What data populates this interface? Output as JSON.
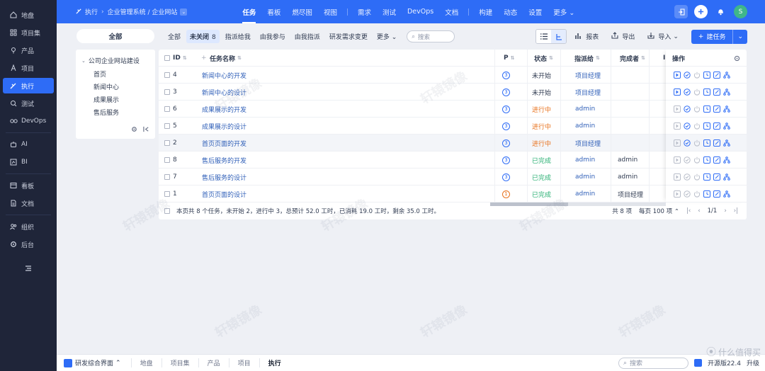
{
  "sidebar": {
    "items": [
      {
        "label": "地盘",
        "icon": "home-icon"
      },
      {
        "label": "项目集",
        "icon": "grid-icon"
      },
      {
        "label": "产品",
        "icon": "pin-icon"
      },
      {
        "label": "项目",
        "icon": "project-icon"
      },
      {
        "label": "执行",
        "icon": "run-icon",
        "active": true
      },
      {
        "label": "测试",
        "icon": "search-icon"
      },
      {
        "label": "DevOps",
        "icon": "infinity-icon"
      },
      {
        "label": "AI",
        "icon": "robot-icon"
      },
      {
        "label": "BI",
        "icon": "chart-icon"
      },
      {
        "label": "看板",
        "icon": "kanban-icon"
      },
      {
        "label": "文档",
        "icon": "doc-icon"
      },
      {
        "label": "组织",
        "icon": "people-icon"
      },
      {
        "label": "后台",
        "icon": "gear-icon"
      }
    ]
  },
  "topbar": {
    "breadcrumb": [
      "执行",
      "企业管理系统 / 企业网站"
    ],
    "nav": [
      "任务",
      "看板",
      "燃尽图",
      "视图",
      "需求",
      "测试",
      "DevOps",
      "文档",
      "构建",
      "动态",
      "设置",
      "更多"
    ],
    "active_nav": "任务",
    "avatar_letter": "S"
  },
  "filters": {
    "all_label": "全部",
    "tabs": [
      {
        "label": "全部"
      },
      {
        "label": "未关闭",
        "count": "8",
        "selected": true
      },
      {
        "label": "指派给我"
      },
      {
        "label": "由我参与"
      },
      {
        "label": "由我指派"
      },
      {
        "label": "研发需求变更"
      },
      {
        "label": "更多"
      }
    ],
    "search_placeholder": "搜索",
    "report_label": "报表",
    "export_label": "导出",
    "import_label": "导入",
    "create_label": "建任务"
  },
  "tree": {
    "root": "公司企业网站建设",
    "nodes": [
      "首页",
      "新闻中心",
      "成果展示",
      "售后服务"
    ]
  },
  "table": {
    "headers": {
      "id": "ID",
      "name": "任务名称",
      "pri": "P",
      "status": "状态",
      "assigned": "指派给",
      "finished": "完成者",
      "extra": "I",
      "ops": "操作"
    },
    "rows": [
      {
        "id": "4",
        "name": "新闻中心的开发",
        "pri": "3",
        "status": "未开始",
        "status_type": "wait",
        "assigned": "项目经理",
        "finished": ""
      },
      {
        "id": "3",
        "name": "新闻中心的设计",
        "pri": "3",
        "status": "未开始",
        "status_type": "wait",
        "assigned": "项目经理",
        "finished": ""
      },
      {
        "id": "6",
        "name": "成果展示的开发",
        "pri": "3",
        "status": "进行中",
        "status_type": "doing",
        "assigned": "admin",
        "finished": ""
      },
      {
        "id": "5",
        "name": "成果展示的设计",
        "pri": "3",
        "status": "进行中",
        "status_type": "doing",
        "assigned": "admin",
        "finished": ""
      },
      {
        "id": "2",
        "name": "首页页面的开发",
        "pri": "3",
        "status": "进行中",
        "status_type": "doing",
        "assigned": "项目经理",
        "finished": "",
        "highlight": true
      },
      {
        "id": "8",
        "name": "售后服务的开发",
        "pri": "3",
        "status": "已完成",
        "status_type": "done",
        "assigned": "admin",
        "finished": "admin"
      },
      {
        "id": "7",
        "name": "售后服务的设计",
        "pri": "3",
        "status": "已完成",
        "status_type": "done",
        "assigned": "admin",
        "finished": "admin"
      },
      {
        "id": "1",
        "name": "首页页面的设计",
        "pri": "1",
        "status": "已完成",
        "status_type": "done",
        "assigned": "admin",
        "finished": "项目经理"
      }
    ],
    "summary": "本页共 8 个任务，未开始 2，进行中 3，总预计 52.0 工时，已消耗 19.0 工时，剩余 35.0 工时。",
    "total": "共 8 项",
    "per_page": "每页 100 项",
    "page": "1/1"
  },
  "taskbar": {
    "app": "研发综合界面",
    "tabs": [
      "地盘",
      "项目集",
      "产品",
      "项目",
      "执行"
    ],
    "current": "执行",
    "search_placeholder": "搜索",
    "version": "开源版22.4",
    "upgrade": "升级"
  },
  "watermark": "什么值得买",
  "colors": {
    "brand": "#2e6cf6",
    "sidebar": "#1f2539",
    "doing": "#e8731f",
    "done": "#2bb074"
  }
}
